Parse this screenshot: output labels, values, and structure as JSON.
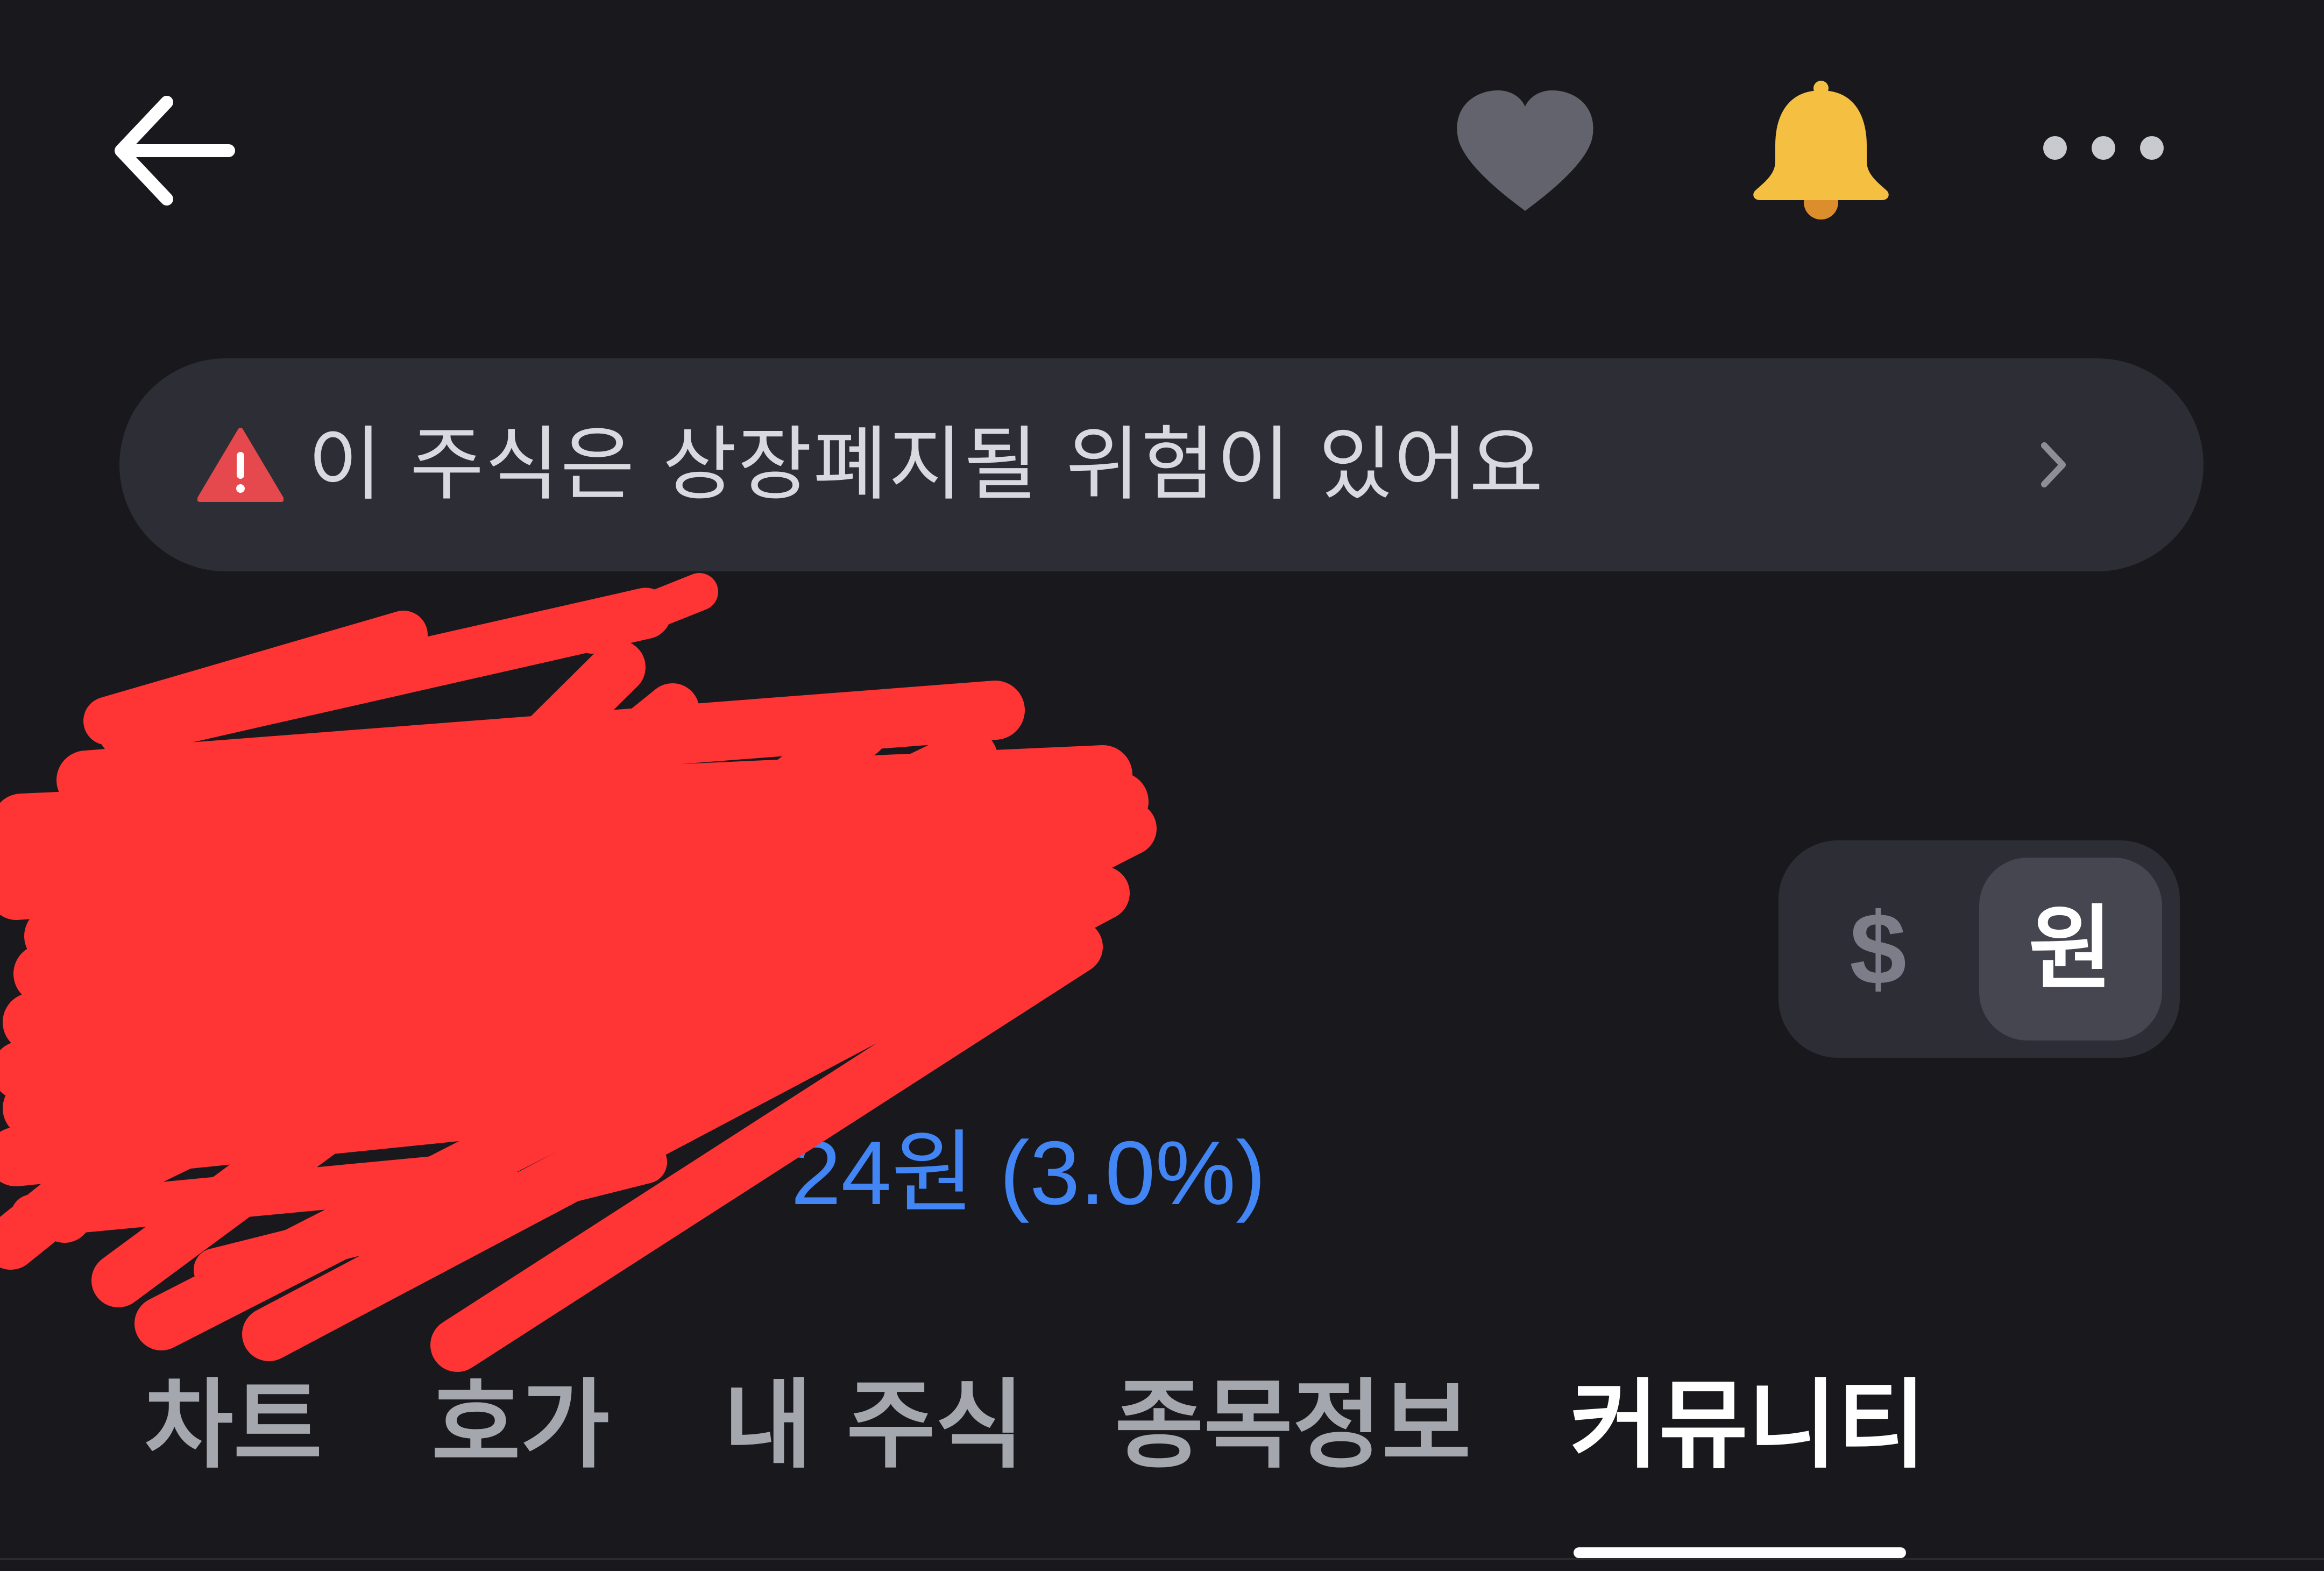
{
  "header": {
    "back_icon": "arrow-left-icon",
    "favorite_icon": "heart-icon",
    "alert_icon": "bell-icon",
    "more_icon": "more-horizontal-icon",
    "bell_color": "#f5bf42",
    "heart_color": "#63636d"
  },
  "warning_banner": {
    "icon": "warning-triangle-icon",
    "text": "이 주식은 상장폐지될 위험이 있어요",
    "chevron_icon": "chevron-right-icon",
    "icon_color": "#e5484d"
  },
  "price": {
    "change": "24원 (3.0%)",
    "change_color": "#4285f4"
  },
  "currency_toggle": {
    "dollar_label": "$",
    "won_label": "원",
    "selected": "원"
  },
  "tabs": [
    {
      "label": "차트",
      "active": false
    },
    {
      "label": "호가",
      "active": false
    },
    {
      "label": "내 주식",
      "active": false
    },
    {
      "label": "종목정보",
      "active": false
    },
    {
      "label": "커뮤니티",
      "active": true
    }
  ]
}
